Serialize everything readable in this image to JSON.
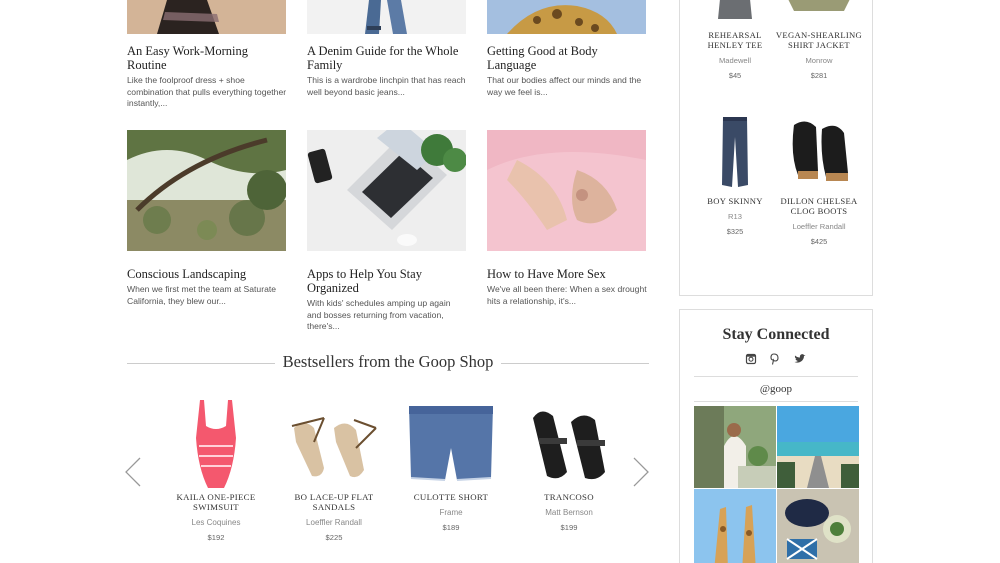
{
  "articles": [
    {
      "title": "An Easy Work-Morning Routine",
      "excerpt": "Like the foolproof dress + shoe combination that pulls everything together instantly,..."
    },
    {
      "title": "A Denim Guide for the Whole Family",
      "excerpt": "This is a wardrobe linchpin that has reach well beyond basic jeans..."
    },
    {
      "title": "Getting Good at Body Language",
      "excerpt": "That our bodies affect our minds and the way we feel is..."
    },
    {
      "title": "Conscious Landscaping",
      "excerpt": "When we first met the team at Saturate California, they blew our..."
    },
    {
      "title": "Apps to Help You Stay Organized",
      "excerpt": "With kids' schedules amping up again and bosses returning from vacation, there's..."
    },
    {
      "title": "How to Have More Sex",
      "excerpt": "We've all been there: When a sex drought hits a relationship, it's..."
    }
  ],
  "bestsellers": {
    "heading": "Bestsellers from the Goop Shop",
    "products": [
      {
        "name": "KAILA ONE-PIECE SWIMSUIT",
        "brand": "Les Coquines",
        "price": "$192"
      },
      {
        "name": "BO LACE-UP FLAT SANDALS",
        "brand": "Loeffler Randall",
        "price": "$225"
      },
      {
        "name": "CULOTTE SHORT",
        "brand": "Frame",
        "price": "$189"
      },
      {
        "name": "TRANCOSO",
        "brand": "Matt Bernson",
        "price": "$199"
      }
    ],
    "prev_icon": "chevron-left-icon",
    "next_icon": "chevron-right-icon"
  },
  "sidebar": {
    "products": [
      {
        "name": "REHEARSAL HENLEY TEE",
        "brand": "Madewell",
        "price": "$45"
      },
      {
        "name": "VEGAN-SHEARLING SHIRT JACKET",
        "brand": "Monrow",
        "price": "$281"
      },
      {
        "name": "BOY SKINNY",
        "brand": "R13",
        "price": "$325"
      },
      {
        "name": "DILLON CHELSEA CLOG BOOTS",
        "brand": "Loeffler Randall",
        "price": "$425"
      }
    ],
    "stay_connected": {
      "title": "Stay Connected",
      "social_icons": [
        "instagram-icon",
        "pinterest-icon",
        "twitter-icon"
      ],
      "handle": "@goop"
    }
  }
}
